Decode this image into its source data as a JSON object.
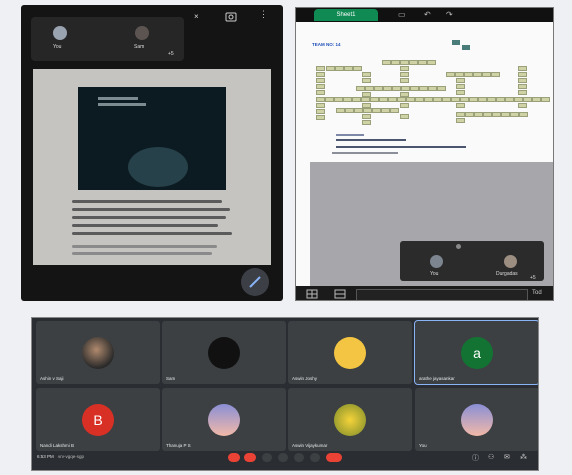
{
  "phone": {
    "pip_you": "You",
    "pip_other": "Sam",
    "pip_more": "+5",
    "poem_lines": [
      "സ്വന്തം വേദനകൾ",
      "സഹിക്കാൻ",
      "പഠിക്കുന്നവർ",
      "ജീവിതം"
    ]
  },
  "sheet": {
    "tab": "Sheet1",
    "heading": "TEAM NO: 14",
    "footer_you": "You",
    "footer_other": "Durgadas",
    "footer_more": "+5",
    "toolbar_right": "Tod"
  },
  "meet": {
    "tiles": [
      {
        "name": "Ashin v Saji",
        "avatar": "photo"
      },
      {
        "name": "Sam",
        "avatar": "dark"
      },
      {
        "name": "Aswin Joshy",
        "avatar": "smiley"
      },
      {
        "name": "arathe jayasankar",
        "avatar": "a"
      },
      {
        "name": "Nandi Lakshmi B",
        "avatar": "B"
      },
      {
        "name": "Thanuja P S",
        "avatar": "tower"
      },
      {
        "name": "Aswin Vijaykumar",
        "avatar": "flower"
      },
      {
        "name": "You",
        "avatar": "tower"
      }
    ],
    "time": "6:53 PM",
    "meeting_code": "vrv-vgqe-sgp"
  }
}
